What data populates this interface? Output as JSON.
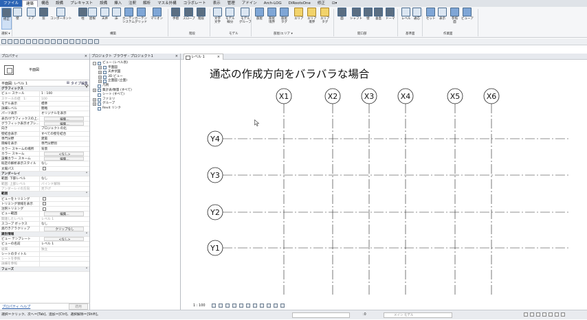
{
  "menu": [
    "ファイル",
    "建築",
    "構造",
    "設備",
    "プレキャスト",
    "設備",
    "挿入",
    "注釈",
    "解析",
    "マス＆外構",
    "コラボレート",
    "表示",
    "管理",
    "アドイン",
    "Arch-LOG",
    "DiRootsOne",
    "修正",
    "⊡▾"
  ],
  "ribbon": {
    "buttons": [
      {
        "name": "modify",
        "label": "修正"
      },
      {
        "name": "wall",
        "label": "壁"
      },
      {
        "name": "door",
        "label": "ドア"
      },
      {
        "name": "window",
        "label": "窓"
      },
      {
        "name": "component",
        "label": "コンポーネント"
      },
      {
        "name": "column",
        "label": "柱"
      },
      {
        "name": "roof",
        "label": "屋根"
      },
      {
        "name": "ceiling",
        "label": "天井"
      },
      {
        "name": "floor",
        "label": "床"
      },
      {
        "name": "curtain-system",
        "label": "カーテン\nシステム"
      },
      {
        "name": "curtain-grid",
        "label": "カーテン\nグリッド"
      },
      {
        "name": "mullion",
        "label": "マリオン"
      },
      {
        "name": "railing",
        "label": "手摺"
      },
      {
        "name": "ramp",
        "label": "スロープ"
      },
      {
        "name": "stair",
        "label": "階段"
      },
      {
        "name": "model-text",
        "label": "文字\n文字"
      },
      {
        "name": "model-line",
        "label": "モデル\n線分"
      },
      {
        "name": "model-group",
        "label": "モデル\nグループ"
      },
      {
        "name": "room",
        "label": "部屋"
      },
      {
        "name": "room-separator",
        "label": "部屋\n境界"
      },
      {
        "name": "tag-room",
        "label": "部屋\nタグ"
      },
      {
        "name": "area",
        "label": "エリア"
      },
      {
        "name": "area-boundary",
        "label": "エリア\n境界"
      },
      {
        "name": "tag-area",
        "label": "エリア\nタグ"
      },
      {
        "name": "by-face",
        "label": "面"
      },
      {
        "name": "shaft",
        "label": "シャフト"
      },
      {
        "name": "wall-opening",
        "label": "壁"
      },
      {
        "name": "vertical",
        "label": "垂直"
      },
      {
        "name": "dormer",
        "label": "ドーマ"
      },
      {
        "name": "level",
        "label": "レベル"
      },
      {
        "name": "grid",
        "label": "通芯"
      },
      {
        "name": "set",
        "label": "セット"
      },
      {
        "name": "show",
        "label": "表示"
      },
      {
        "name": "ref-plane",
        "label": "参照\n面"
      },
      {
        "name": "viewer",
        "label": "ビューア"
      }
    ],
    "groups": [
      "選択 ▾",
      "構築",
      "階段",
      "モデル",
      "部屋/エリア ▾",
      "開口部",
      "基準面",
      "作業面"
    ]
  },
  "properties": {
    "header": "プロパティ",
    "close": "×",
    "type_name": "平面図",
    "instance": "平面図: レベル 1",
    "edit_type": "タイプ編集",
    "rows": [
      {
        "k": "グラフィックス",
        "cat": true
      },
      {
        "k": "ビュー スケール",
        "v": "1 : 100"
      },
      {
        "k": "スケールの値　1:",
        "v": "100",
        "gray": true
      },
      {
        "k": "モデル表示",
        "v": "標準"
      },
      {
        "k": "詳細レベル",
        "v": "簡略"
      },
      {
        "k": "パーツ表示",
        "v": "オリジナルを表示"
      },
      {
        "k": "表示/グラフィックスの上...",
        "v": "編集...",
        "btn": true
      },
      {
        "k": "グラフィック表示オプシ...",
        "v": "編集...",
        "btn": true
      },
      {
        "k": "向き",
        "v": "プロジェクトの北"
      },
      {
        "k": "壁結合表示",
        "v": "すべての壁を結合"
      },
      {
        "k": "専門分野",
        "v": "建築"
      },
      {
        "k": "隠線を表示",
        "v": "専門分野別"
      },
      {
        "k": "カラー スキームの場所",
        "v": "背景"
      },
      {
        "k": "カラー スキーム",
        "v": "<なし>",
        "btn": true
      },
      {
        "k": "設備カラー スキーム",
        "v": "編集...",
        "btn": true
      },
      {
        "k": "既定の解析表示スタイル",
        "v": "なし"
      },
      {
        "k": "太陽パス",
        "v": "",
        "cb": true
      },
      {
        "k": "アンダーレイ",
        "cat": true
      },
      {
        "k": "範囲: 下部レベル",
        "v": "なし"
      },
      {
        "k": "範囲: 上部レベル",
        "v": "バインド解除",
        "gray": true
      },
      {
        "k": "アンダーレイの方向",
        "v": "見下げ",
        "gray": true
      },
      {
        "k": "範囲",
        "cat": true
      },
      {
        "k": "ビューをトリミング",
        "v": "",
        "cb": true
      },
      {
        "k": "トリミング領域を表示",
        "v": "",
        "cb": true
      },
      {
        "k": "注釈トリミング",
        "v": "",
        "cb": true
      },
      {
        "k": "ビュー範囲",
        "v": "編集...",
        "btn": true
      },
      {
        "k": "関連したレベル",
        "v": "レベル 1",
        "gray": true
      },
      {
        "k": "スコープ ボックス",
        "v": "なし"
      },
      {
        "k": "奥行きアラクリップ",
        "v": "クリップなし",
        "btn": true
      },
      {
        "k": "識別情報",
        "cat": true
      },
      {
        "k": "ビュー テンプレート",
        "v": "<なし>",
        "btn": true
      },
      {
        "k": "ビューの名前",
        "v": "レベル 1"
      },
      {
        "k": "従属",
        "v": "独立",
        "gray": true
      },
      {
        "k": "シートのタイトル",
        "v": ""
      },
      {
        "k": "シートを参照",
        "v": "",
        "gray": true
      },
      {
        "k": "詳細を参照",
        "v": "",
        "gray": true
      },
      {
        "k": "フェーズ",
        "cat": true
      }
    ],
    "help_link": "プロパティ ヘルプ",
    "apply": "適用"
  },
  "browser": {
    "header": "プロジェクト ブラウザ - プロジェクト1",
    "close": "×",
    "items": [
      {
        "label": "ビュー (レベル別)",
        "level": 0,
        "pm": "−"
      },
      {
        "label": "平面図",
        "level": 1,
        "pm": "+"
      },
      {
        "label": "天井伏図",
        "level": 1,
        "pm": "+"
      },
      {
        "label": "3D ビュー",
        "level": 1,
        "pm": "+"
      },
      {
        "label": "立面図 (立面)",
        "level": 1,
        "pm": "+"
      },
      {
        "label": "凡例",
        "level": 0,
        "pm": ""
      },
      {
        "label": "集計表/数量 (すべて)",
        "level": 0,
        "pm": "+"
      },
      {
        "label": "シート (すべて)",
        "level": 0,
        "pm": ""
      },
      {
        "label": "ファミリ",
        "level": 0,
        "pm": "+"
      },
      {
        "label": "グループ",
        "level": 0,
        "pm": "+"
      },
      {
        "label": "Revit リンク",
        "level": 0,
        "pm": ""
      }
    ]
  },
  "view_tab": {
    "label": "レベル 1",
    "close": "×"
  },
  "canvas": {
    "title": "通芯の作成方向をバラバラな場合",
    "grid_x": [
      "X1",
      "X2",
      "X3",
      "X4",
      "X5",
      "X6"
    ],
    "grid_y": [
      "Y4",
      "Y3",
      "Y2",
      "Y1"
    ]
  },
  "view_control": {
    "scale": "1 : 100"
  },
  "status": {
    "text": "選択＝クリック、次へ＝[Tab]、追加＝[Ctrl]、選択解除＝[Shift]。",
    "zero": ":0",
    "main_model": "メイン モデル"
  }
}
